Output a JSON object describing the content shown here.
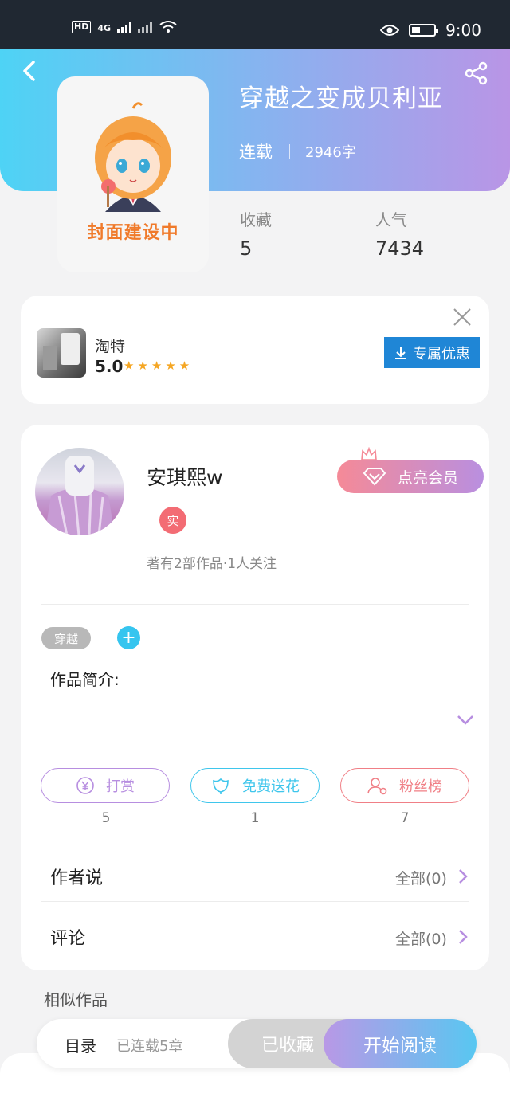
{
  "status_bar": {
    "hd": "HD",
    "network": "4G",
    "time": "9:00"
  },
  "book": {
    "cover_placeholder": "封面建设中",
    "title": "穿越之变成贝利亚",
    "status": "连载",
    "word_count": "2946字",
    "stats": [
      {
        "label": "收藏",
        "value": "5"
      },
      {
        "label": "人气",
        "value": "7434"
      }
    ]
  },
  "ad": {
    "name": "淘特",
    "rating": "5.0",
    "stars": 5,
    "button_label": "专属优惠"
  },
  "author": {
    "name": "安琪熙w",
    "verified_badge": "实",
    "meta": "著有2部作品·1人关注",
    "vip_button": "点亮会员"
  },
  "tags": [
    "穿越"
  ],
  "intro_label": "作品简介:",
  "actions": [
    {
      "label": "打赏",
      "icon": "yen-icon",
      "count": "5",
      "color": "#b78ee0"
    },
    {
      "label": "免费送花",
      "icon": "flower-icon",
      "count": "1",
      "color": "#3fc6ec"
    },
    {
      "label": "粉丝榜",
      "icon": "fans-icon",
      "count": "7",
      "color": "#f07f86"
    }
  ],
  "rows": [
    {
      "label": "作者说",
      "value": "全部(0)"
    },
    {
      "label": "评论",
      "value": "全部(0)"
    }
  ],
  "similar_label": "相似作品",
  "bottom_bar": {
    "toc": "目录",
    "chapters": "已连载5章",
    "collected": "已收藏",
    "read": "开始阅读"
  },
  "colors": {
    "accent_purple": "#b998e6",
    "accent_cyan": "#4ed3f5"
  }
}
